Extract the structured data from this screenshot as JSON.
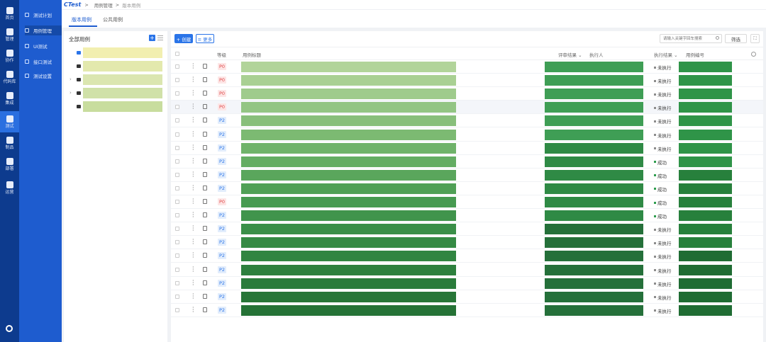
{
  "rail": [
    {
      "label": "首页",
      "icon": "home-icon"
    },
    {
      "label": "管理",
      "icon": "manage-icon"
    },
    {
      "label": "协作",
      "icon": "collab-icon"
    },
    {
      "label": "代码库",
      "icon": "repo-icon"
    },
    {
      "label": "集成",
      "icon": "integration-icon"
    },
    {
      "label": "测试",
      "icon": "test-icon",
      "active": true
    },
    {
      "label": "制品",
      "icon": "artifact-icon"
    },
    {
      "label": "部署",
      "icon": "deploy-icon"
    },
    {
      "label": "运营",
      "icon": "ops-icon"
    }
  ],
  "subnav": [
    {
      "label": "测试计划",
      "icon": "plan-icon"
    },
    {
      "label": "用例管理",
      "icon": "case-icon",
      "active": true
    },
    {
      "label": "UI测试",
      "icon": "ui-test-icon"
    },
    {
      "label": "接口测试",
      "icon": "api-test-icon"
    },
    {
      "label": "测试设置",
      "icon": "settings-icon"
    }
  ],
  "breadcrumb": {
    "brand": "CTest",
    "sep": ">",
    "level1": "用例管理",
    "level2": "版本用例"
  },
  "tabs": [
    "版本用例",
    "公共用例"
  ],
  "tree": {
    "title": "全部用例",
    "add": "+",
    "nodes": [
      {
        "folder": "blue",
        "caret": "",
        "color": "#f2efb0"
      },
      {
        "folder": "dark",
        "caret": "",
        "color": "#e3e9ad"
      },
      {
        "folder": "dark",
        "caret": "›",
        "color": "#dbe6b0"
      },
      {
        "folder": "dark",
        "caret": "›",
        "color": "#d0e1a8"
      },
      {
        "folder": "dark",
        "caret": "",
        "color": "#c8dd9e"
      }
    ]
  },
  "toolbar": {
    "create": "+ 创建",
    "more": "≡ 更多",
    "search_placeholder": "请输入关键字回车搜索",
    "filter": "筛选",
    "expand": "⛶"
  },
  "table": {
    "headers": {
      "level": "等级",
      "title": "用例标题",
      "review": "评审结果",
      "executor": "执行人",
      "exec_result": "执行结果",
      "case_no": "用例编号"
    },
    "rows": [
      {
        "p": "P0",
        "status": "未执行",
        "ok": false,
        "c": "#b2d49a"
      },
      {
        "p": "P0",
        "status": "未执行",
        "ok": false,
        "c": "#a9d093"
      },
      {
        "p": "P0",
        "status": "未执行",
        "ok": false,
        "c": "#9fcb8c"
      },
      {
        "p": "P0",
        "status": "未执行",
        "ok": false,
        "c": "#93c584",
        "hl": true
      },
      {
        "p": "P2",
        "status": "未执行",
        "ok": false,
        "c": "#88bf7b"
      },
      {
        "p": "P2",
        "status": "未执行",
        "ok": false,
        "c": "#7cba72"
      },
      {
        "p": "P2",
        "status": "未执行",
        "ok": false,
        "c": "#6fb36a"
      },
      {
        "p": "P2",
        "status": "成功",
        "ok": true,
        "c": "#64ad63"
      },
      {
        "p": "P2",
        "status": "成功",
        "ok": true,
        "c": "#5aa65c"
      },
      {
        "p": "P2",
        "status": "成功",
        "ok": true,
        "c": "#50a056"
      },
      {
        "p": "P0",
        "status": "成功",
        "ok": true,
        "c": "#479a51"
      },
      {
        "p": "P2",
        "status": "成功",
        "ok": true,
        "c": "#40944c"
      },
      {
        "p": "P2",
        "status": "未执行",
        "ok": false,
        "c": "#3a8f48"
      },
      {
        "p": "P2",
        "status": "未执行",
        "ok": false,
        "c": "#358a44"
      },
      {
        "p": "P2",
        "status": "未执行",
        "ok": false,
        "c": "#318541"
      },
      {
        "p": "P2",
        "status": "未执行",
        "ok": false,
        "c": "#2d803e"
      },
      {
        "p": "P2",
        "status": "未执行",
        "ok": false,
        "c": "#2a7b3b"
      },
      {
        "p": "P2",
        "status": "未执行",
        "ok": false,
        "c": "#287638"
      },
      {
        "p": "P2",
        "status": "未执行",
        "ok": false,
        "c": "#257236"
      }
    ]
  }
}
